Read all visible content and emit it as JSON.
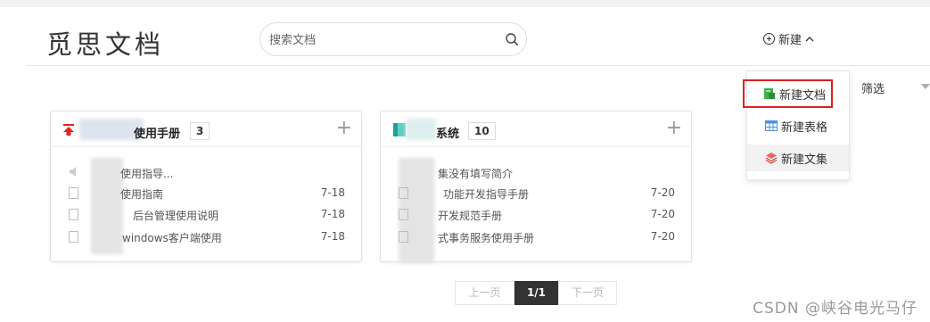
{
  "logo": {
    "text": "觅思文档"
  },
  "search": {
    "placeholder": "搜索文档",
    "value": ""
  },
  "header": {
    "new_label": "新建",
    "filter_label": "筛选"
  },
  "new_menu": {
    "items": [
      {
        "label": "新建文档",
        "icon": "doc-green-icon"
      },
      {
        "label": "新建表格",
        "icon": "table-icon"
      },
      {
        "label": "新建文集",
        "icon": "layers-icon"
      }
    ]
  },
  "cards": [
    {
      "title": "使用手册",
      "count": "3",
      "docs": [
        {
          "title": "使用指导...",
          "date": ""
        },
        {
          "title": "使用指南",
          "date": "7-18"
        },
        {
          "title": "后台管理使用说明",
          "date": "7-18"
        },
        {
          "title": "windows客户端使用",
          "date": "7-18"
        }
      ]
    },
    {
      "title": "系统",
      "count": "10",
      "docs": [
        {
          "title": "集没有填写简介",
          "date": ""
        },
        {
          "title": "功能开发指导手册",
          "date": "7-20"
        },
        {
          "title": "开发规范手册",
          "date": "7-20"
        },
        {
          "title": "式事务服务使用手册",
          "date": "7-20"
        }
      ]
    }
  ],
  "pagination": {
    "prev": "上一页",
    "current": "1/1",
    "next": "下一页"
  },
  "watermark": "CSDN @峡谷电光马仔",
  "colors": {
    "accent_red": "#e02020",
    "dark": "#333333"
  }
}
